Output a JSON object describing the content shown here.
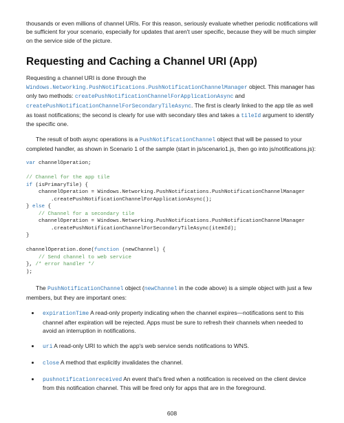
{
  "intro": "thousands or even millions of channel URIs. For this reason, seriously evaluate whether periodic notifications will be sufficient for your scenario, especially for updates that aren't user specific, because they will be much simpler on the service side of the picture.",
  "heading": "Requesting and Caching a Channel URI (App)",
  "p1_a": "Requesting a channel URI is done through the ",
  "p1_code1": "Windows.Networking.PushNotifications.PushNotificationChannelManager",
  "p1_b": " object. This manager has only two methods: ",
  "p1_code2": "createPushNotificationChannelForApplicationAsync",
  "p1_c": " and ",
  "p1_code3": "createPushNotificationChannelForSecondaryTileAsync",
  "p1_d": ". The first is clearly linked to the app tile as well as toast notifications; the second is clearly for use with secondary tiles and takes a ",
  "p1_code4": "tileId",
  "p1_e": " argument to identify the specific one.",
  "p2_a": "The result of both async operations is a ",
  "p2_code1": "PushNotificationChannel",
  "p2_b": " object that will be passed to your completed handler, as shown in Scenario 1 of the sample (start in js/scenario1.js, then go into js/notifications.js):",
  "code": {
    "l1a": "var",
    "l1b": " channelOperation;",
    "l2": "// Channel for the app tile",
    "l3a": "if",
    "l3b": " (isPrimaryTile) {",
    "l4": "    channelOperation = Windows.Networking.PushNotifications.PushNotificationChannelManager",
    "l5": "        .createPushNotificationChannelForApplicationAsync();",
    "l6a": "} ",
    "l6b": "else",
    "l6c": " {",
    "l7": "    // Channel for a secondary tile",
    "l8": "    channelOperation = Windows.Networking.PushNotifications.PushNotificationChannelManager",
    "l9": "        .createPushNotificationChannelForSecondaryTileAsync(itemId);",
    "l10": "}",
    "l11a": "channelOperation.done(",
    "l11b": "function",
    "l11c": " (newChannel) {",
    "l12": "    // Send channel to web service",
    "l13a": "}, ",
    "l13b": "/* error handler */",
    "l14": ");"
  },
  "p3_a": "The ",
  "p3_code1": "PushNotificationChannel",
  "p3_b": " object (",
  "p3_code2": "newChannel",
  "p3_c": " in the code above) is a simple object with just a few members, but they are important ones:",
  "bullets": {
    "b1_code": "expirationTime",
    "b1_text": "    A read-only property indicating when the channel expires—notifications sent to this channel after expiration will be rejected. Apps must be sure to refresh their channels when needed to avoid an interruption in notifications.",
    "b2_code": "uri",
    "b2_text": "    A read-only URI to which the app's web service sends notifications to WNS.",
    "b3_code": "close",
    "b3_text": "    A method that explicitly invalidates the channel.",
    "b4_code": "pushnotificationreceived",
    "b4_text": "    An event that's fired when a notification is received on the client device from this notification channel. This will be fired only for apps that are in the foreground."
  },
  "pagenum": "608"
}
